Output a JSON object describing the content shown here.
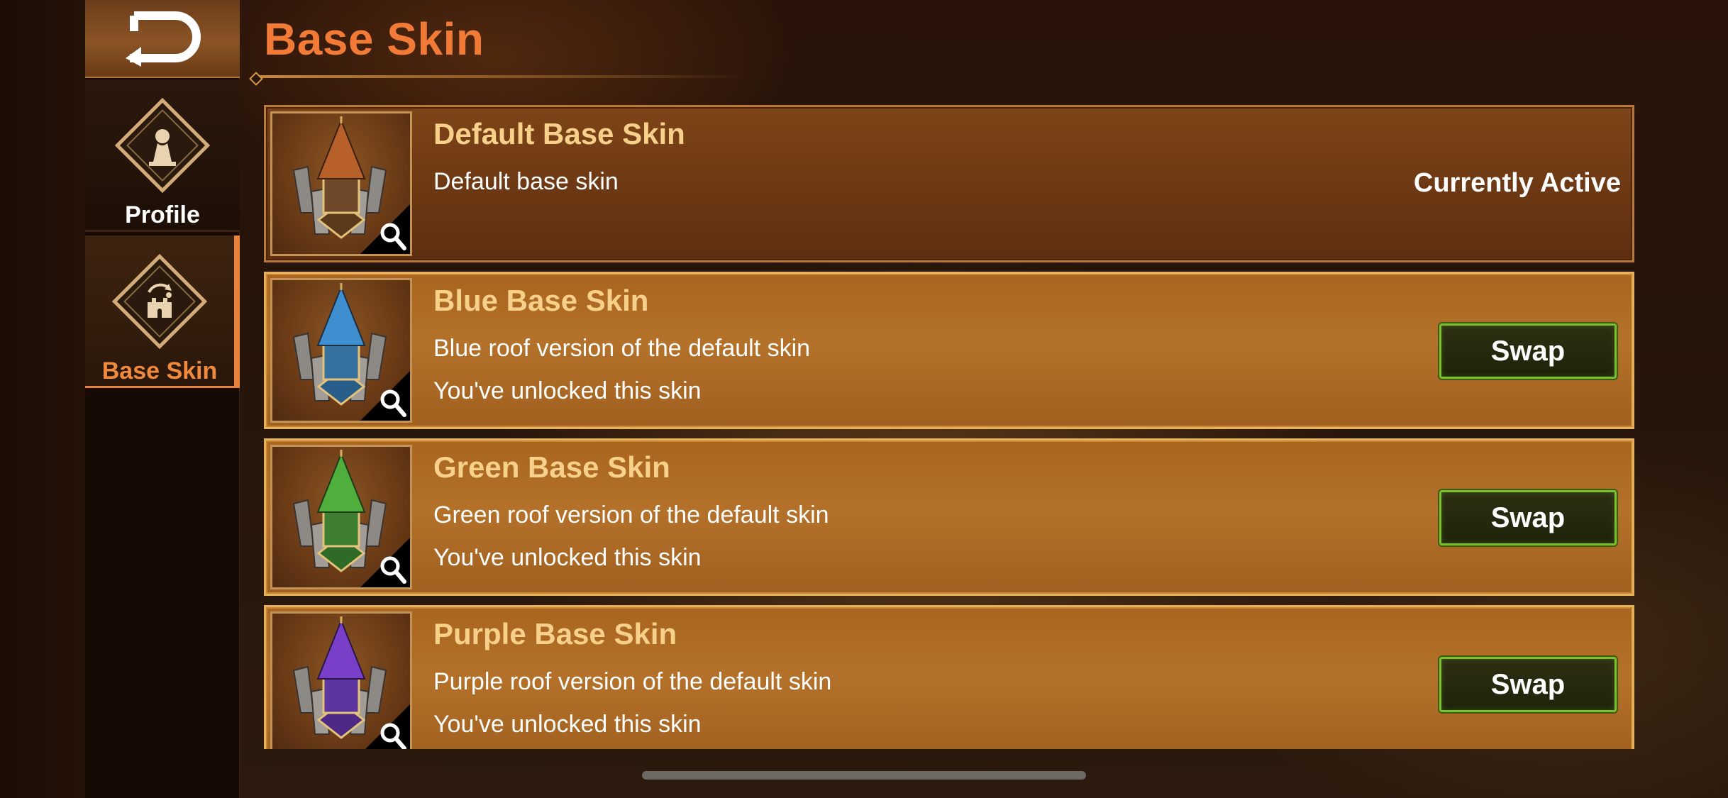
{
  "header": {
    "title": "Base Skin"
  },
  "sidebar": {
    "back_icon": "back-arrow-icon",
    "items": [
      {
        "label": "Profile",
        "icon": "profile-pawn-icon",
        "selected": false
      },
      {
        "label": "Base Skin",
        "icon": "castle-swap-icon",
        "selected": true
      }
    ]
  },
  "skins": [
    {
      "name": "Default Base Skin",
      "description": "Default base skin",
      "status": "",
      "action_label": "Currently Active",
      "roof_color": "#b8602a",
      "active": true
    },
    {
      "name": "Blue Base Skin",
      "description": "Blue roof version of the default skin",
      "status": "You've unlocked this skin",
      "action_label": "Swap",
      "roof_color": "#3f8fd0",
      "active": false
    },
    {
      "name": "Green Base Skin",
      "description": "Green roof version of the default skin",
      "status": "You've unlocked this skin",
      "action_label": "Swap",
      "roof_color": "#4fae3c",
      "active": false
    },
    {
      "name": "Purple Base Skin",
      "description": "Purple roof version of the default skin",
      "status": "You've unlocked this skin",
      "action_label": "Swap",
      "roof_color": "#7a3fc8",
      "active": false
    }
  ],
  "colors": {
    "accent": "#f07a36",
    "card_title": "#f7d08a",
    "swap_border": "#7bc12e"
  }
}
